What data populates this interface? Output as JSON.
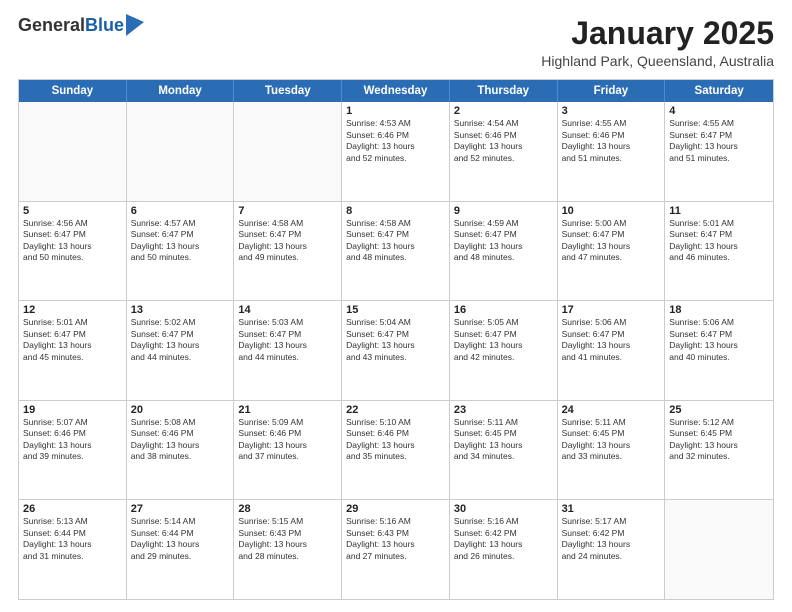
{
  "logo": {
    "general": "General",
    "blue": "Blue"
  },
  "header": {
    "month": "January 2025",
    "location": "Highland Park, Queensland, Australia"
  },
  "weekdays": [
    "Sunday",
    "Monday",
    "Tuesday",
    "Wednesday",
    "Thursday",
    "Friday",
    "Saturday"
  ],
  "rows": [
    [
      {
        "day": "",
        "info": ""
      },
      {
        "day": "",
        "info": ""
      },
      {
        "day": "",
        "info": ""
      },
      {
        "day": "1",
        "info": "Sunrise: 4:53 AM\nSunset: 6:46 PM\nDaylight: 13 hours\nand 52 minutes."
      },
      {
        "day": "2",
        "info": "Sunrise: 4:54 AM\nSunset: 6:46 PM\nDaylight: 13 hours\nand 52 minutes."
      },
      {
        "day": "3",
        "info": "Sunrise: 4:55 AM\nSunset: 6:46 PM\nDaylight: 13 hours\nand 51 minutes."
      },
      {
        "day": "4",
        "info": "Sunrise: 4:55 AM\nSunset: 6:47 PM\nDaylight: 13 hours\nand 51 minutes."
      }
    ],
    [
      {
        "day": "5",
        "info": "Sunrise: 4:56 AM\nSunset: 6:47 PM\nDaylight: 13 hours\nand 50 minutes."
      },
      {
        "day": "6",
        "info": "Sunrise: 4:57 AM\nSunset: 6:47 PM\nDaylight: 13 hours\nand 50 minutes."
      },
      {
        "day": "7",
        "info": "Sunrise: 4:58 AM\nSunset: 6:47 PM\nDaylight: 13 hours\nand 49 minutes."
      },
      {
        "day": "8",
        "info": "Sunrise: 4:58 AM\nSunset: 6:47 PM\nDaylight: 13 hours\nand 48 minutes."
      },
      {
        "day": "9",
        "info": "Sunrise: 4:59 AM\nSunset: 6:47 PM\nDaylight: 13 hours\nand 48 minutes."
      },
      {
        "day": "10",
        "info": "Sunrise: 5:00 AM\nSunset: 6:47 PM\nDaylight: 13 hours\nand 47 minutes."
      },
      {
        "day": "11",
        "info": "Sunrise: 5:01 AM\nSunset: 6:47 PM\nDaylight: 13 hours\nand 46 minutes."
      }
    ],
    [
      {
        "day": "12",
        "info": "Sunrise: 5:01 AM\nSunset: 6:47 PM\nDaylight: 13 hours\nand 45 minutes."
      },
      {
        "day": "13",
        "info": "Sunrise: 5:02 AM\nSunset: 6:47 PM\nDaylight: 13 hours\nand 44 minutes."
      },
      {
        "day": "14",
        "info": "Sunrise: 5:03 AM\nSunset: 6:47 PM\nDaylight: 13 hours\nand 44 minutes."
      },
      {
        "day": "15",
        "info": "Sunrise: 5:04 AM\nSunset: 6:47 PM\nDaylight: 13 hours\nand 43 minutes."
      },
      {
        "day": "16",
        "info": "Sunrise: 5:05 AM\nSunset: 6:47 PM\nDaylight: 13 hours\nand 42 minutes."
      },
      {
        "day": "17",
        "info": "Sunrise: 5:06 AM\nSunset: 6:47 PM\nDaylight: 13 hours\nand 41 minutes."
      },
      {
        "day": "18",
        "info": "Sunrise: 5:06 AM\nSunset: 6:47 PM\nDaylight: 13 hours\nand 40 minutes."
      }
    ],
    [
      {
        "day": "19",
        "info": "Sunrise: 5:07 AM\nSunset: 6:46 PM\nDaylight: 13 hours\nand 39 minutes."
      },
      {
        "day": "20",
        "info": "Sunrise: 5:08 AM\nSunset: 6:46 PM\nDaylight: 13 hours\nand 38 minutes."
      },
      {
        "day": "21",
        "info": "Sunrise: 5:09 AM\nSunset: 6:46 PM\nDaylight: 13 hours\nand 37 minutes."
      },
      {
        "day": "22",
        "info": "Sunrise: 5:10 AM\nSunset: 6:46 PM\nDaylight: 13 hours\nand 35 minutes."
      },
      {
        "day": "23",
        "info": "Sunrise: 5:11 AM\nSunset: 6:45 PM\nDaylight: 13 hours\nand 34 minutes."
      },
      {
        "day": "24",
        "info": "Sunrise: 5:11 AM\nSunset: 6:45 PM\nDaylight: 13 hours\nand 33 minutes."
      },
      {
        "day": "25",
        "info": "Sunrise: 5:12 AM\nSunset: 6:45 PM\nDaylight: 13 hours\nand 32 minutes."
      }
    ],
    [
      {
        "day": "26",
        "info": "Sunrise: 5:13 AM\nSunset: 6:44 PM\nDaylight: 13 hours\nand 31 minutes."
      },
      {
        "day": "27",
        "info": "Sunrise: 5:14 AM\nSunset: 6:44 PM\nDaylight: 13 hours\nand 29 minutes."
      },
      {
        "day": "28",
        "info": "Sunrise: 5:15 AM\nSunset: 6:43 PM\nDaylight: 13 hours\nand 28 minutes."
      },
      {
        "day": "29",
        "info": "Sunrise: 5:16 AM\nSunset: 6:43 PM\nDaylight: 13 hours\nand 27 minutes."
      },
      {
        "day": "30",
        "info": "Sunrise: 5:16 AM\nSunset: 6:42 PM\nDaylight: 13 hours\nand 26 minutes."
      },
      {
        "day": "31",
        "info": "Sunrise: 5:17 AM\nSunset: 6:42 PM\nDaylight: 13 hours\nand 24 minutes."
      },
      {
        "day": "",
        "info": ""
      }
    ]
  ]
}
